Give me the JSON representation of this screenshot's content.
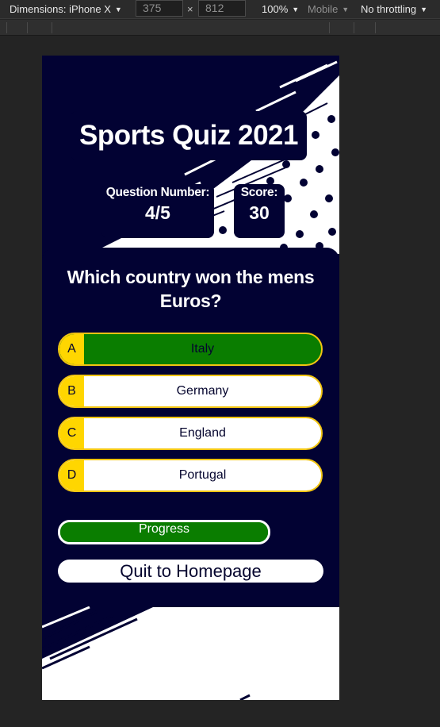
{
  "devtools": {
    "dimensions_label": "Dimensions: iPhone X",
    "width_value": "375",
    "times": "×",
    "height_value": "812",
    "zoom": "100%",
    "network": "Mobile",
    "throttling": "No throttling"
  },
  "quiz": {
    "title": "Sports Quiz 2021",
    "question_number_label": "Question Number:",
    "question_number_value": "4/5",
    "score_label": "Score:",
    "score_value": "30",
    "question": "Which country won the mens Euros?",
    "answers": [
      {
        "letter": "A",
        "text": "Italy",
        "selected": true
      },
      {
        "letter": "B",
        "text": "Germany",
        "selected": false
      },
      {
        "letter": "C",
        "text": "England",
        "selected": false
      },
      {
        "letter": "D",
        "text": "Portugal",
        "selected": false
      }
    ],
    "progress_label": "Progress",
    "progress": 1.0,
    "quit_label": "Quit to Homepage"
  },
  "colors": {
    "navy": "#020233",
    "accent_yellow": "#ffd600",
    "selected_green": "#0a7d00",
    "border_gold": "#f2c511"
  }
}
